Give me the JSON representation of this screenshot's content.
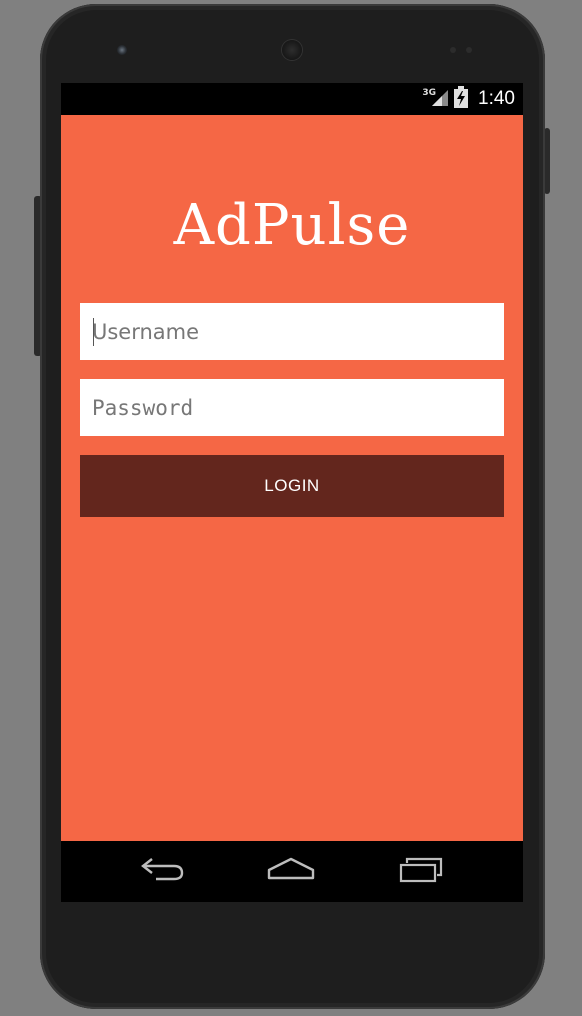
{
  "device": {
    "model_icons": [
      "front-camera-icon",
      "earpiece-icon",
      "sensor-icon"
    ]
  },
  "status_bar": {
    "network_type": "3G",
    "time": "1:40",
    "icons": [
      "signal-icon",
      "battery-charging-icon"
    ]
  },
  "app": {
    "title": "AdPulse",
    "background_color": "#f56745",
    "username": {
      "placeholder": "Username",
      "value": ""
    },
    "password": {
      "placeholder": "Password",
      "value": ""
    },
    "login_button": {
      "label": "LOGIN",
      "color": "#63261d"
    }
  },
  "nav_bar": {
    "buttons": [
      "back-icon",
      "home-icon",
      "recent-apps-icon"
    ]
  }
}
